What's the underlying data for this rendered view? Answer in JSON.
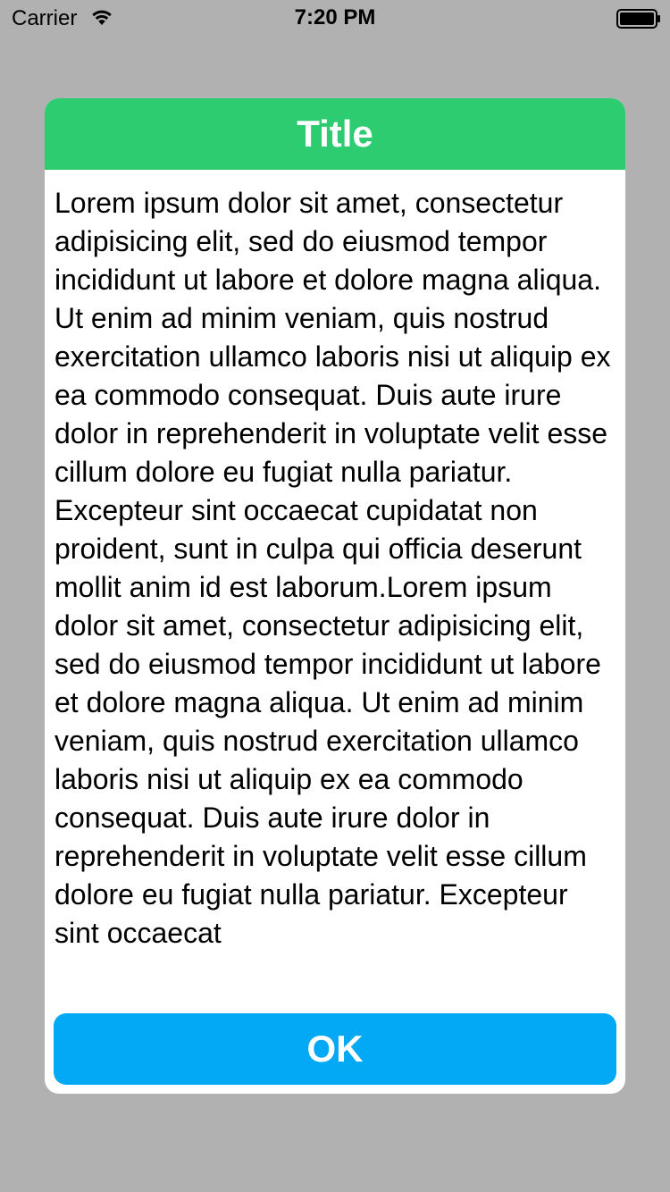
{
  "status_bar": {
    "carrier": "Carrier",
    "time": "7:20 PM",
    "wifi_icon": "wifi-icon",
    "battery_icon": "battery-icon"
  },
  "dialog": {
    "title": "Title",
    "body": "Lorem ipsum dolor sit amet, consectetur adipisicing elit, sed do eiusmod tempor incididunt ut labore et dolore magna aliqua. Ut enim ad minim veniam, quis nostrud exercitation ullamco laboris nisi ut aliquip ex ea commodo consequat. Duis aute irure dolor in reprehenderit in voluptate velit esse cillum dolore eu fugiat nulla pariatur. Excepteur sint occaecat cupidatat non proident, sunt in culpa qui officia deserunt mollit anim id est laborum.Lorem ipsum dolor sit amet, consectetur adipisicing elit, sed do eiusmod tempor incididunt ut labore et dolore magna aliqua. Ut enim ad minim veniam, quis nostrud exercitation ullamco laboris nisi ut aliquip ex ea commodo consequat. Duis aute irure dolor in reprehenderit in voluptate velit esse cillum dolore eu fugiat nulla pariatur. Excepteur sint occaecat",
    "ok_label": "OK"
  },
  "colors": {
    "backdrop": "#b1b1b1",
    "header": "#2ecc71",
    "button": "#03a9f4",
    "dialog_bg": "#ffffff"
  }
}
